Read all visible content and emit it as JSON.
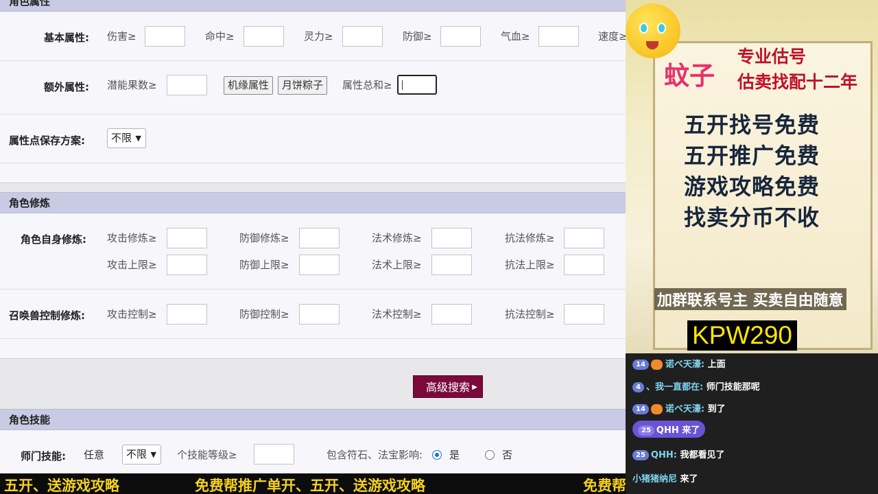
{
  "attr": {
    "header": "角色属性",
    "basic_label": "基本属性:",
    "basic_fields": [
      "伤害≥",
      "命中≥",
      "灵力≥",
      "防御≥",
      "气血≥",
      "速度≥"
    ],
    "extra_label": "额外属性:",
    "potential": "潜能果数≥",
    "btn_jiyuan": "机缘属性",
    "btn_yuebing": "月饼粽子",
    "total": "属性总和≥",
    "save_label": "属性点保存方案:",
    "save_value": "不限"
  },
  "cultivation": {
    "header": "角色修炼",
    "self_label": "角色自身修炼:",
    "self_row1": [
      "攻击修炼≥",
      "防御修炼≥",
      "法术修炼≥",
      "抗法修炼≥"
    ],
    "self_row2": [
      "攻击上限≥",
      "防御上限≥",
      "法术上限≥",
      "抗法上限≥"
    ],
    "pet_label": "召唤兽控制修炼:",
    "pet_row": [
      "攻击控制≥",
      "防御控制≥",
      "法术控制≥",
      "抗法控制≥"
    ]
  },
  "search_button": "高级搜索",
  "skills": {
    "header": "角色技能",
    "school_label": "师门技能:",
    "any": "任意",
    "select_value": "不限",
    "level": "个技能等级≥",
    "include": "包含符石、法宝影响:",
    "yes": "是",
    "no": "否"
  },
  "ticker": [
    "五开、送游戏攻略",
    "免费帮推广单开、五开、送游戏攻略",
    "免费帮"
  ],
  "promo": {
    "brand": "蚊子",
    "line1": "专业估号",
    "line2": "估卖找配十二年",
    "big": [
      "五开找号免费",
      "五开推广免费",
      "游戏攻略免费",
      "找卖分币不收"
    ],
    "bottom": "加群联系号主 买卖自由随意",
    "code": "KPW290"
  },
  "chat": [
    {
      "level": "14",
      "user": "诺ベ天濠:",
      "text": "上面"
    },
    {
      "level": "4",
      "user": "、我一直都在:",
      "text": "师门技能那呢"
    },
    {
      "level": "14",
      "user": "诺ベ天濠:",
      "text": "到了"
    },
    {
      "level": "25",
      "user": "QHH",
      "text": "来了"
    },
    {
      "level": "25",
      "user": "QHH:",
      "text": "我都看见了"
    },
    {
      "level": "",
      "user": "小猪猪纳尼",
      "text": "来了"
    }
  ]
}
